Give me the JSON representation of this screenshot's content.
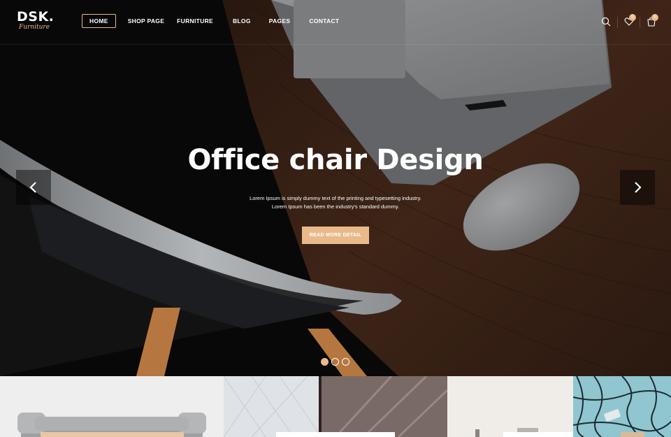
{
  "brand": {
    "name": "DSK.",
    "tagline": "Furniture"
  },
  "nav": {
    "items": [
      {
        "label": "HOME",
        "active": true
      },
      {
        "label": "SHOP PAGE"
      },
      {
        "label": "FURNITURE"
      },
      {
        "label": "BLOG"
      },
      {
        "label": "PAGES"
      },
      {
        "label": "CONTACT"
      }
    ]
  },
  "header_icons": [
    {
      "icon": "search-icon"
    },
    {
      "icon": "heart-icon",
      "badge": "0"
    },
    {
      "icon": "cart-icon",
      "badge": "0"
    }
  ],
  "hero": {
    "title": "Office chair Design",
    "line1": "Lorem Ipsum is simply dummy text of the printing and typesetting industry.",
    "line2": "Lorem Ipsum has been the industry's standard dummy.",
    "button": "READ MORE DETAIL",
    "slides": 3,
    "active_slide": 1,
    "prev_icon": "chevron-left-icon",
    "next_icon": "chevron-right-icon"
  },
  "colors": {
    "accent": "#e9b98a",
    "dark": "#0d0d0d",
    "wood": "#4a2c1c"
  }
}
